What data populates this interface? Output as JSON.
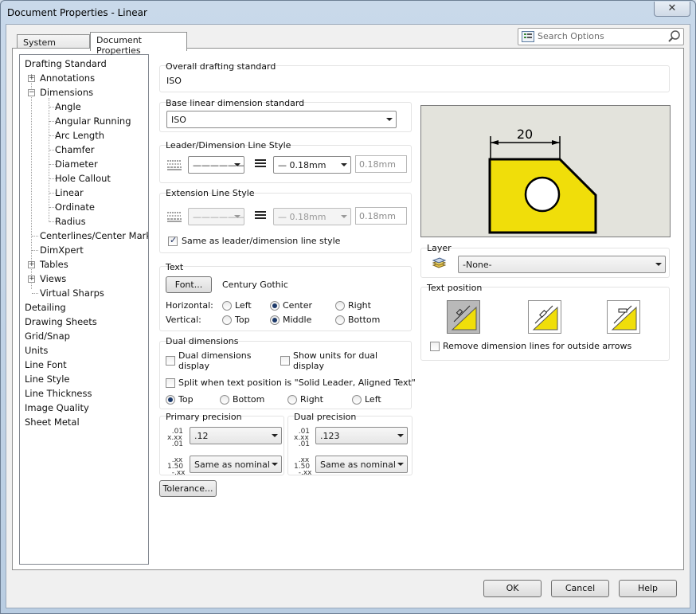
{
  "window": {
    "title": "Document Properties - Linear",
    "close_icon": "close-icon"
  },
  "tabs": [
    {
      "label": "System Options"
    },
    {
      "label": "Document Properties"
    }
  ],
  "search": {
    "placeholder": "Search Options"
  },
  "tree": {
    "items": [
      {
        "label": "Drafting Standard"
      },
      {
        "label": "Annotations"
      },
      {
        "label": "Dimensions"
      },
      {
        "label": "Angle"
      },
      {
        "label": "Angular Running"
      },
      {
        "label": "Arc Length"
      },
      {
        "label": "Chamfer"
      },
      {
        "label": "Diameter"
      },
      {
        "label": "Hole Callout"
      },
      {
        "label": "Linear"
      },
      {
        "label": "Ordinate"
      },
      {
        "label": "Radius"
      },
      {
        "label": "Centerlines/Center Marks"
      },
      {
        "label": "DimXpert"
      },
      {
        "label": "Tables"
      },
      {
        "label": "Views"
      },
      {
        "label": "Virtual Sharps"
      },
      {
        "label": "Detailing"
      },
      {
        "label": "Drawing Sheets"
      },
      {
        "label": "Grid/Snap"
      },
      {
        "label": "Units"
      },
      {
        "label": "Line Font"
      },
      {
        "label": "Line Style"
      },
      {
        "label": "Line Thickness"
      },
      {
        "label": "Image Quality"
      },
      {
        "label": "Sheet Metal"
      }
    ]
  },
  "overall": {
    "title": "Overall drafting standard",
    "value": "ISO"
  },
  "base": {
    "title": "Base linear dimension standard",
    "value": "ISO"
  },
  "leader": {
    "title": "Leader/Dimension Line Style",
    "style": "——————",
    "thickness": "— 0.18mm",
    "custom": "0.18mm"
  },
  "extension": {
    "title": "Extension Line Style",
    "style": "——————",
    "thickness": "— 0.18mm",
    "custom": "0.18mm",
    "same_label": "Same as leader/dimension line style"
  },
  "text": {
    "title": "Text",
    "font_button": "Font...",
    "font_name": "Century Gothic",
    "horizontal_label": "Horizontal:",
    "vertical_label": "Vertical:",
    "h_options": [
      "Left",
      "Center",
      "Right"
    ],
    "v_options": [
      "Top",
      "Middle",
      "Bottom"
    ]
  },
  "dual": {
    "title": "Dual dimensions",
    "display_label": "Dual dimensions display",
    "units_label": "Show units for dual display",
    "split_label": "Split when text position is \"Solid Leader, Aligned Text\"",
    "pos_options": [
      "Top",
      "Bottom",
      "Right",
      "Left"
    ]
  },
  "primary": {
    "title": "Primary precision",
    "value": ".12",
    "tol": "Same as nominal"
  },
  "dualprec": {
    "title": "Dual precision",
    "value": ".123",
    "tol": "Same as nominal"
  },
  "tolerance_button": "Tolerance...",
  "preview": {
    "dimension": "20"
  },
  "layer": {
    "title": "Layer",
    "value": "-None-"
  },
  "textpos": {
    "title": "Text position",
    "remove_label": "Remove dimension lines for outside arrows"
  },
  "footer": {
    "ok": "OK",
    "cancel": "Cancel",
    "help": "Help"
  },
  "colors": {
    "part_fill": "#f0de0a",
    "preview_bg": "#e3e3dc"
  }
}
